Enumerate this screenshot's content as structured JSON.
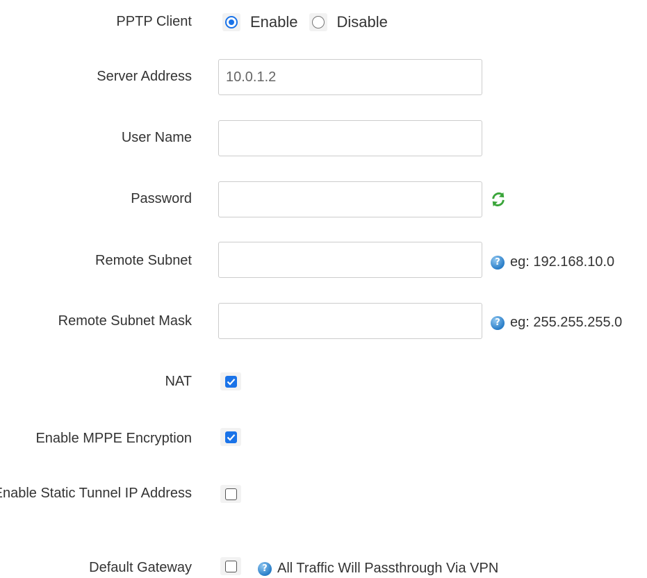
{
  "pptp_client": {
    "label": "PPTP Client",
    "options": [
      {
        "label": "Enable",
        "selected": true
      },
      {
        "label": "Disable",
        "selected": false
      }
    ]
  },
  "server_address": {
    "label": "Server Address",
    "value": "10.0.1.2"
  },
  "user_name": {
    "label": "User Name",
    "value": ""
  },
  "password": {
    "label": "Password",
    "value": "",
    "icon": "refresh-icon"
  },
  "remote_subnet": {
    "label": "Remote Subnet",
    "value": "",
    "hint": "eg: 192.168.10.0",
    "icon": "help-icon"
  },
  "remote_subnet_mask": {
    "label": "Remote Subnet Mask",
    "value": "",
    "hint": "eg: 255.255.255.0",
    "icon": "help-icon"
  },
  "nat": {
    "label": "NAT",
    "checked": true
  },
  "mppe": {
    "label": "Enable MPPE Encryption",
    "checked": true
  },
  "static_tunnel": {
    "label": "Enable Static Tunnel IP Address",
    "checked": false
  },
  "default_gateway": {
    "label": "Default Gateway",
    "checked": false,
    "hint": "All Traffic Will Passthrough Via VPN",
    "icon": "help-icon"
  },
  "colors": {
    "accent": "#1a73e8",
    "refresh_green": "#3aa53a",
    "help_blue": "#2a7ec8"
  }
}
